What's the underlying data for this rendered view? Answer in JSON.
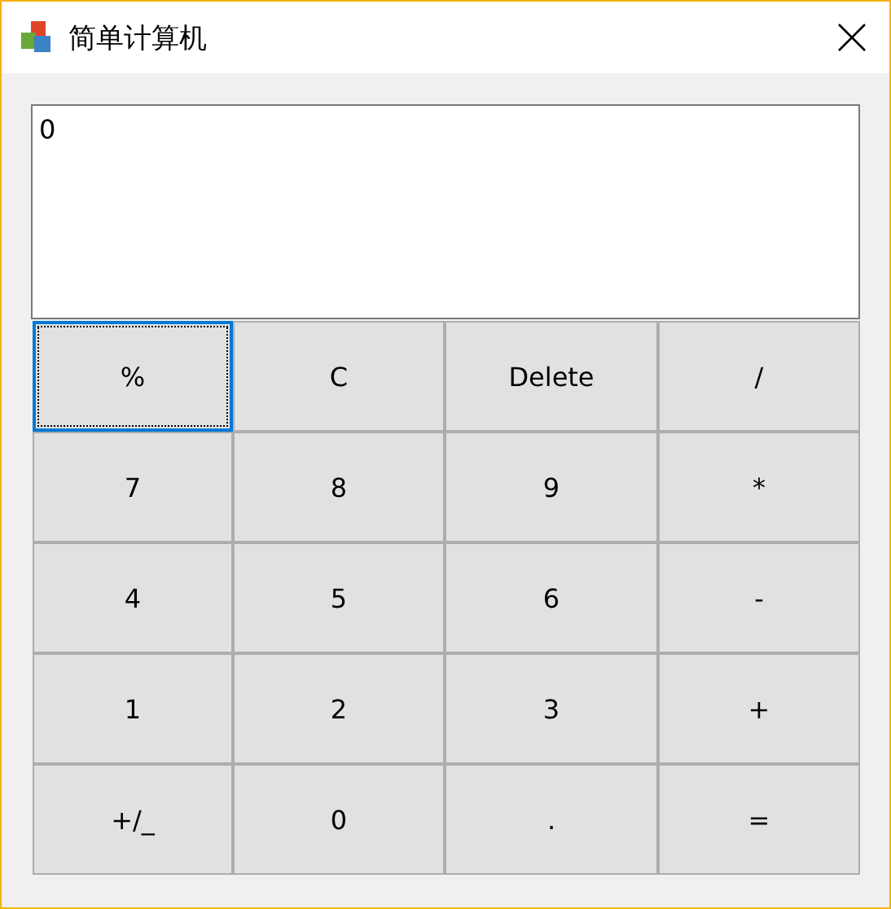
{
  "window": {
    "title": "简单计算机"
  },
  "display": {
    "value": "0"
  },
  "buttons": [
    {
      "label": "%",
      "focused": true
    },
    {
      "label": "C",
      "focused": false
    },
    {
      "label": "Delete",
      "focused": false
    },
    {
      "label": "/",
      "focused": false
    },
    {
      "label": "7",
      "focused": false
    },
    {
      "label": "8",
      "focused": false
    },
    {
      "label": "9",
      "focused": false
    },
    {
      "label": "*",
      "focused": false
    },
    {
      "label": "4",
      "focused": false
    },
    {
      "label": "5",
      "focused": false
    },
    {
      "label": "6",
      "focused": false
    },
    {
      "label": "-",
      "focused": false
    },
    {
      "label": "1",
      "focused": false
    },
    {
      "label": "2",
      "focused": false
    },
    {
      "label": "3",
      "focused": false
    },
    {
      "label": "+",
      "focused": false
    },
    {
      "label": "+/_",
      "focused": false
    },
    {
      "label": "0",
      "focused": false
    },
    {
      "label": ".",
      "focused": false
    },
    {
      "label": "=",
      "focused": false
    }
  ]
}
